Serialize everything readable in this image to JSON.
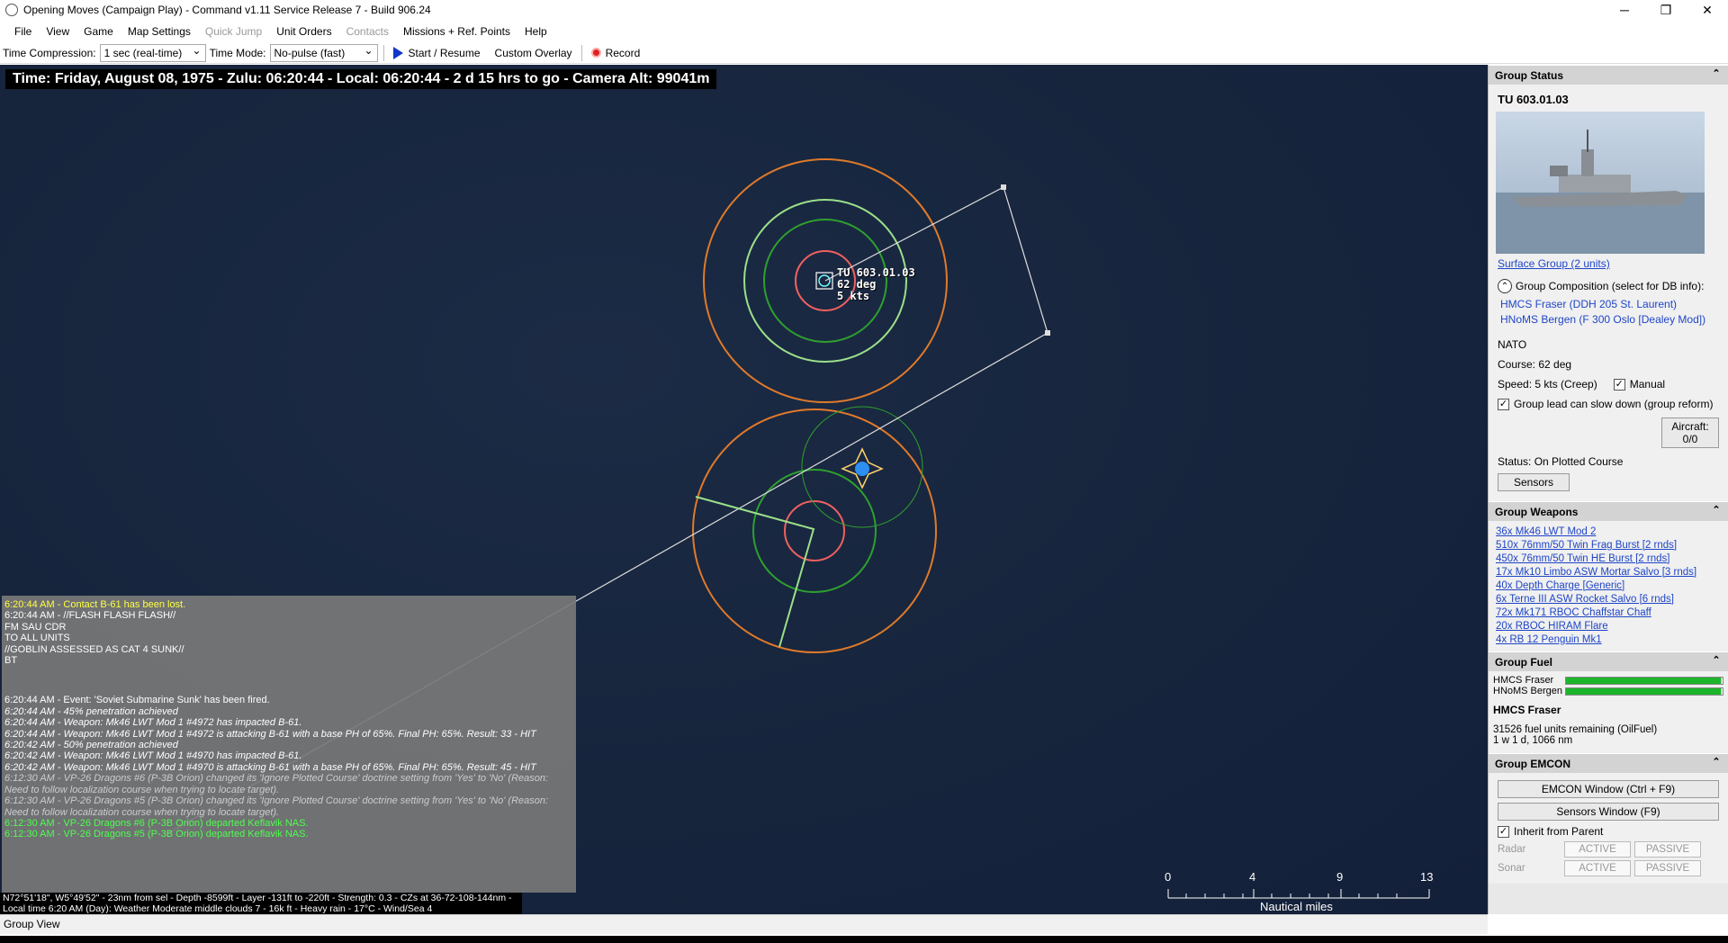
{
  "window": {
    "title": "Opening Moves (Campaign Play) - Command v1.11 Service Release 7 - Build 906.24",
    "controls": [
      "─",
      "❐",
      "✕"
    ]
  },
  "menu": {
    "items": [
      {
        "label": "File",
        "enabled": true
      },
      {
        "label": "View",
        "enabled": true
      },
      {
        "label": "Game",
        "enabled": true
      },
      {
        "label": "Map Settings",
        "enabled": true
      },
      {
        "label": "Quick Jump",
        "enabled": false
      },
      {
        "label": "Unit Orders",
        "enabled": true
      },
      {
        "label": "Contacts",
        "enabled": false
      },
      {
        "label": "Missions + Ref. Points",
        "enabled": true
      },
      {
        "label": "Help",
        "enabled": true
      }
    ]
  },
  "toolbar": {
    "time_compression_label": "Time Compression:",
    "time_compression_value": "1 sec (real-time)",
    "time_mode_label": "Time Mode:",
    "time_mode_value": "No-pulse (fast)",
    "start_label": "Start / Resume",
    "overlay_label": "Custom Overlay",
    "record_label": "Record"
  },
  "map": {
    "time_bar": "Time: Friday, August 08, 1975 - Zulu: 06:20:44 - Local: 06:20:44 - 2 d 15 hrs to go -  Camera Alt: 99041m",
    "unit_label": [
      "TU 603.01.03",
      "62 deg",
      "5 kts"
    ],
    "cursor_info": [
      "N72°51'18\", W5°49'52\" - 23nm from sel - Depth -8599ft - Layer -131ft to -220ft - Strength: 0.3 - CZs at 36-72-108-144nm -",
      "Local time 6:20 AM (Day): Weather Moderate middle clouds 7 - 16k ft - Heavy rain - 17°C - Wind/Sea 4"
    ],
    "scale": {
      "ticks": [
        "0",
        "4",
        "9",
        "13"
      ],
      "unit": "Nautical miles"
    },
    "colors": {
      "sea": "#16243c",
      "range_orange": "#e07a2a",
      "range_green": "#2ea02e",
      "range_lightgreen": "#9be08a",
      "range_red": "#f06060"
    }
  },
  "message_log": [
    {
      "style": "yellow",
      "text": "6:20:44 AM - Contact B-61 has been lost."
    },
    {
      "style": "white",
      "text": "6:20:44 AM - //FLASH FLASH FLASH//\nFM SAU CDR\nTO ALL UNITS\n//GOBLIN ASSESSED AS CAT 4 SUNK//\nBT"
    },
    {
      "style": "gap",
      "text": ""
    },
    {
      "style": "white",
      "text": "6:20:44 AM - Event: 'Soviet Submarine Sunk' has been fired."
    },
    {
      "style": "italic",
      "text": "6:20:44 AM - 45% penetration achieved"
    },
    {
      "style": "italic",
      "text": "6:20:44 AM - Weapon: Mk46 LWT Mod 1 #4972 has impacted B-61."
    },
    {
      "style": "italic",
      "text": "6:20:44 AM - Weapon: Mk46 LWT Mod 1 #4972 is attacking B-61 with a base PH of 65%. Final PH: 65%. Result: 33 - HIT"
    },
    {
      "style": "italic",
      "text": "6:20:42 AM - 50% penetration achieved"
    },
    {
      "style": "italic",
      "text": "6:20:42 AM - Weapon: Mk46 LWT Mod 1 #4970 has impacted B-61."
    },
    {
      "style": "italic",
      "text": "6:20:42 AM - Weapon: Mk46 LWT Mod 1 #4970 is attacking B-61 with a base PH of 65%. Final PH: 65%. Result: 45 - HIT"
    },
    {
      "style": "dim",
      "text": "6:12:30 AM - VP-26 Dragons #6 (P-3B Orion) changed its 'Ignore Plotted Course' doctrine setting from 'Yes' to 'No' (Reason: Need to follow localization course when trying to locate target)."
    },
    {
      "style": "dim",
      "text": "6:12:30 AM - VP-26 Dragons #5 (P-3B Orion) changed its 'Ignore Plotted Course' doctrine setting from 'Yes' to 'No' (Reason: Need to follow localization course when trying to locate target)."
    },
    {
      "style": "green",
      "text": "6:12:30 AM - VP-26 Dragons #6 (P-3B Orion) departed Keflavik NAS."
    },
    {
      "style": "green",
      "text": "6:12:30 AM - VP-26 Dragons #5 (P-3B Orion) departed Keflavik NAS."
    }
  ],
  "status_bar": {
    "text": "Group View"
  },
  "panel": {
    "group_status": {
      "header": "Group Status",
      "name": "TU 603.01.03",
      "type_link": "Surface Group (2 units)",
      "composition_label": "Group Composition (select for DB info):",
      "members": [
        "HMCS Fraser (DDH 205 St. Laurent)",
        "HNoMS Bergen (F 300 Oslo [Dealey Mod])"
      ],
      "side": "NATO",
      "course": "Course: 62 deg",
      "speed": "Speed: 5 kts (Creep)",
      "manual_label": "Manual",
      "slowdown_label": "Group lead can slow down (group reform)",
      "aircraft_button": "Aircraft: 0/0",
      "status": "Status: On Plotted Course",
      "sensors_button": "Sensors"
    },
    "group_weapons": {
      "header": "Group Weapons",
      "items": [
        "36x Mk46 LWT Mod 2",
        "510x 76mm/50 Twin Frag Burst [2 rnds]",
        "450x 76mm/50 Twin HE Burst [2 rnds]",
        "17x Mk10 Limbo ASW Mortar Salvo [3 rnds]",
        "40x Depth Charge [Generic]",
        "6x Terne III ASW Rocket Salvo [6 rnds]",
        "72x Mk171 RBOC Chaffstar Chaff",
        "20x RBOC HIRAM Flare",
        "4x RB 12 Penguin Mk1"
      ]
    },
    "group_fuel": {
      "header": "Group Fuel",
      "bars": [
        {
          "name": "HMCS Fraser",
          "level": 0.99
        },
        {
          "name": "HNoMS Bergen",
          "level": 0.99
        }
      ],
      "selected": "HMCS Fraser",
      "remaining": "31526 fuel units remaining (OilFuel)",
      "endurance": "1 w 1 d, 1066 nm"
    },
    "group_emcon": {
      "header": "Group EMCON",
      "emcon_button": "EMCON Window (Ctrl + F9)",
      "sensors_button": "Sensors Window (F9)",
      "inherit_label": "Inherit from Parent",
      "rows": [
        {
          "label": "Radar",
          "active": "ACTIVE",
          "passive": "PASSIVE"
        },
        {
          "label": "Sonar",
          "active": "ACTIVE",
          "passive": "PASSIVE"
        }
      ]
    }
  }
}
